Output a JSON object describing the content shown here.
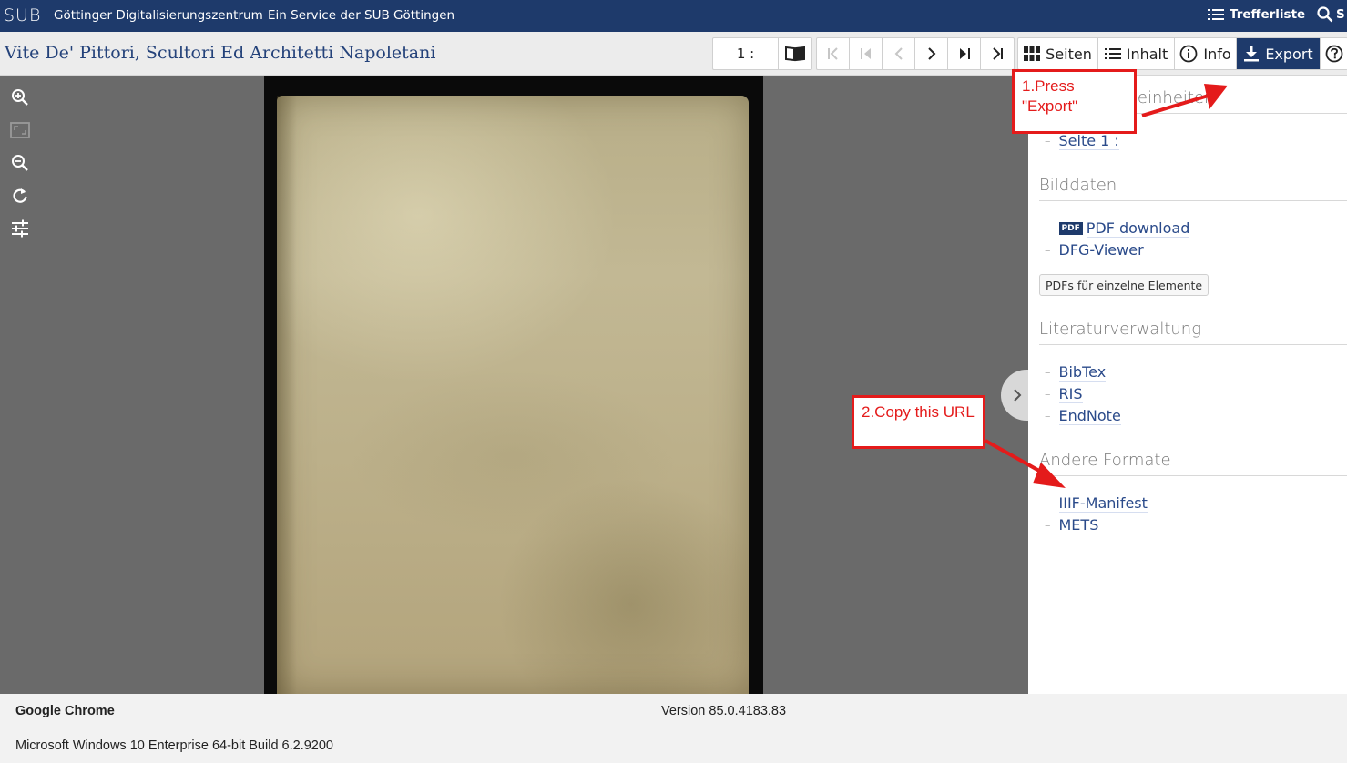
{
  "topbar": {
    "logo": "SUB",
    "site_name": "Göttinger Digitalisierungszentrum",
    "service": "Ein Service der SUB Göttingen",
    "trefferliste": "Trefferliste",
    "search_label": "S"
  },
  "titlebar": {
    "title": "Vite De' Pittori, Scultori Ed Architetti Napoletani",
    "page_indicator": "1 :",
    "seiten": "Seiten",
    "inhalt": "Inhalt",
    "info": "Info",
    "export": "Export"
  },
  "sidebar": {
    "section1_title": "Gliederungseinheiten",
    "section1_items": [
      "Seite 1 :"
    ],
    "bilddaten_title": "Bilddaten",
    "pdf_badge": "PDF",
    "bilddaten_items": [
      "PDF download",
      "DFG-Viewer"
    ],
    "pdf_elements_button": "PDFs für einzelne Elemente",
    "literatur_title": "Literaturverwaltung",
    "literatur_items": [
      "BibTex",
      "RIS",
      "EndNote"
    ],
    "andere_title": "Andere Formate",
    "andere_items": [
      "IIIF-Manifest",
      "METS"
    ]
  },
  "annotations": {
    "step1_line1": "1.Press",
    "step1_line2": "\"Export\"",
    "step2": "2.Copy this URL",
    "color": "#e41b1b"
  },
  "footer": {
    "browser": "Google Chrome",
    "version": "Version 85.0.4183.83",
    "os": "Microsoft Windows 10 Enterprise 64-bit Build 6.2.9200"
  },
  "colors": {
    "navy": "#1e3a6b",
    "link": "#2a4a8a"
  }
}
